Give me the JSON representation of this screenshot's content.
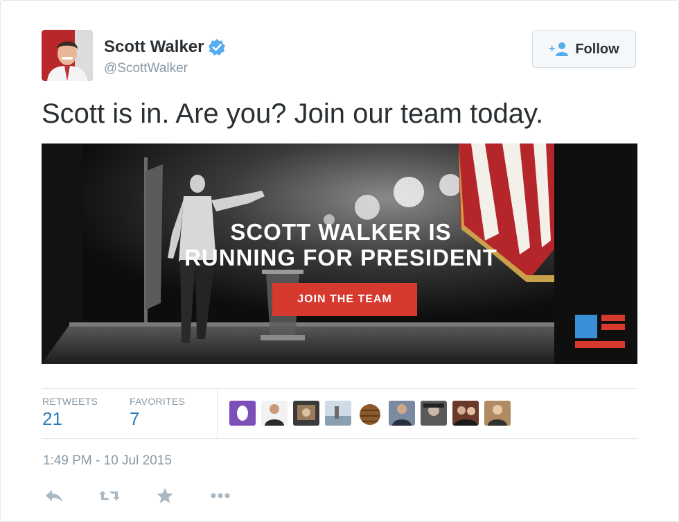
{
  "colors": {
    "text": "#292f33",
    "muted": "#8899a6",
    "link_blue": "#2b7bb9",
    "verified_blue": "#55acee",
    "cta_red": "#d63a2f",
    "border": "#e1e8ed"
  },
  "user": {
    "display_name": "Scott Walker",
    "handle": "@ScottWalker",
    "verified_icon": "verified-badge-icon",
    "avatar_icon": "user-avatar"
  },
  "follow_button": {
    "label": "Follow",
    "icon": "add-user-icon"
  },
  "tweet": {
    "text": "Scott is in. Are you? Join our team today."
  },
  "media": {
    "headline_line1": "SCOTT WALKER IS",
    "headline_line2": "RUNNING FOR PRESIDENT",
    "cta_label": "JOIN THE TEAM",
    "logo_icon": "flag-logo-icon"
  },
  "stats": {
    "retweets_label": "RETWEETS",
    "retweets_value": "21",
    "favorites_label": "FAVORITES",
    "favorites_value": "7"
  },
  "timestamp": "1:49 PM - 10 Jul 2015",
  "actions": [
    {
      "icon": "reply-icon"
    },
    {
      "icon": "retweet-icon"
    },
    {
      "icon": "favorite-star-icon"
    },
    {
      "icon": "more-icon"
    }
  ]
}
